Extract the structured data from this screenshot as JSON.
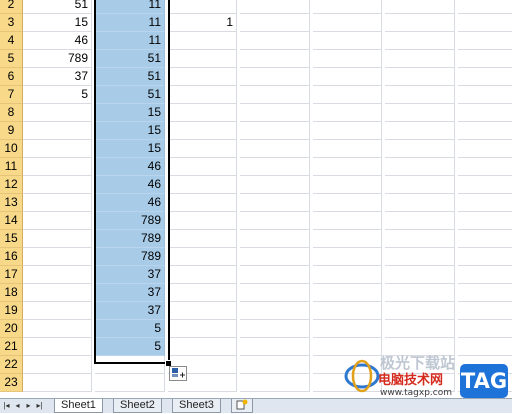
{
  "rows": [
    {
      "num": "2",
      "a": "51",
      "b": "11",
      "c": ""
    },
    {
      "num": "3",
      "a": "15",
      "b": "11",
      "c": "1"
    },
    {
      "num": "4",
      "a": "46",
      "b": "11",
      "c": ""
    },
    {
      "num": "5",
      "a": "789",
      "b": "51",
      "c": ""
    },
    {
      "num": "6",
      "a": "37",
      "b": "51",
      "c": ""
    },
    {
      "num": "7",
      "a": "5",
      "b": "51",
      "c": ""
    },
    {
      "num": "8",
      "a": "",
      "b": "15",
      "c": ""
    },
    {
      "num": "9",
      "a": "",
      "b": "15",
      "c": ""
    },
    {
      "num": "10",
      "a": "",
      "b": "15",
      "c": ""
    },
    {
      "num": "11",
      "a": "",
      "b": "46",
      "c": ""
    },
    {
      "num": "12",
      "a": "",
      "b": "46",
      "c": ""
    },
    {
      "num": "13",
      "a": "",
      "b": "46",
      "c": ""
    },
    {
      "num": "14",
      "a": "",
      "b": "789",
      "c": ""
    },
    {
      "num": "15",
      "a": "",
      "b": "789",
      "c": ""
    },
    {
      "num": "16",
      "a": "",
      "b": "789",
      "c": ""
    },
    {
      "num": "17",
      "a": "",
      "b": "37",
      "c": ""
    },
    {
      "num": "18",
      "a": "",
      "b": "37",
      "c": ""
    },
    {
      "num": "19",
      "a": "",
      "b": "37",
      "c": ""
    },
    {
      "num": "20",
      "a": "",
      "b": "5",
      "c": ""
    },
    {
      "num": "21",
      "a": "",
      "b": "5",
      "c": ""
    },
    {
      "num": "22",
      "a": "",
      "b": "",
      "c": ""
    },
    {
      "num": "23",
      "a": "",
      "b": "",
      "c": ""
    }
  ],
  "sheet_tabs": [
    "Sheet1",
    "Sheet2",
    "Sheet3"
  ],
  "active_tab": "Sheet1",
  "watermark": {
    "line1": "极光下载站",
    "line2": "电脑技术网",
    "line3": "www.tagxp.com",
    "badge": "TAG"
  },
  "colors": {
    "row_header": "#f7d989",
    "selection": "#a8cbe8",
    "gridline": "#d8dce2",
    "badge_blue": "#1e73d8",
    "watermark_red": "#d52b1e"
  }
}
